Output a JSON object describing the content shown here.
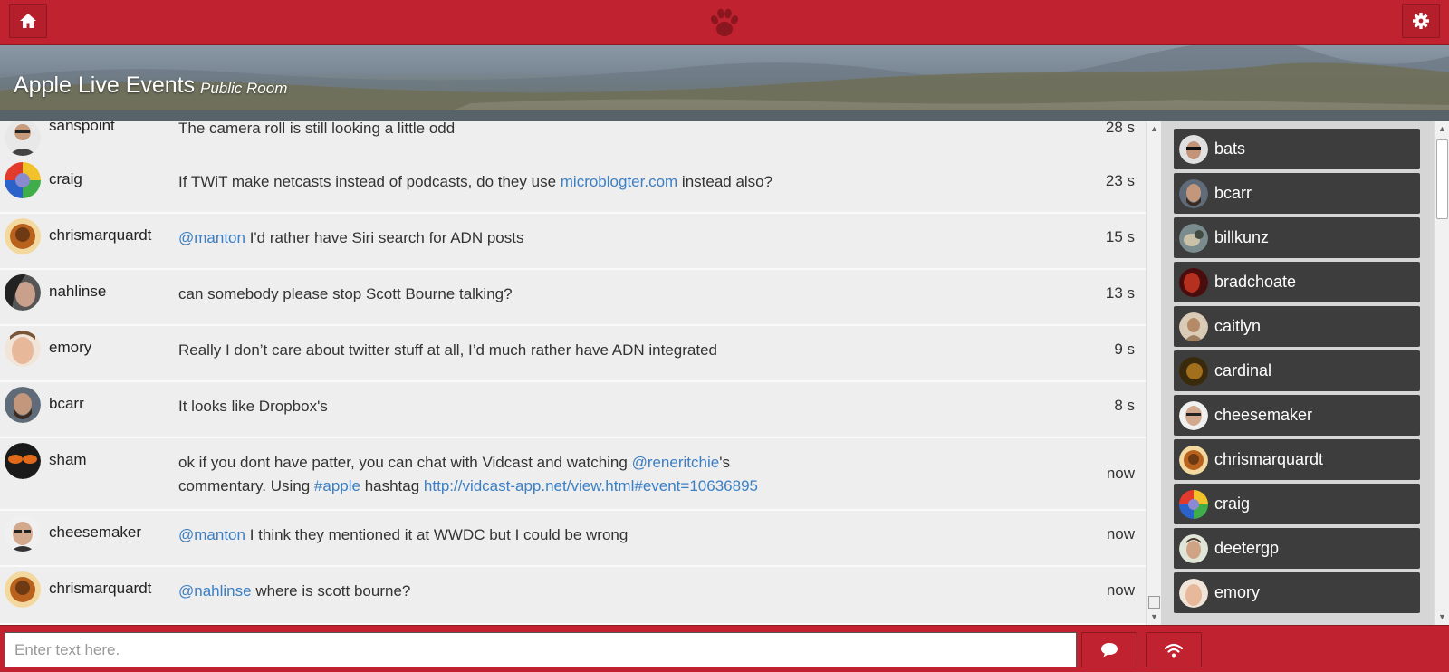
{
  "room": {
    "title": "Apple Live Events",
    "type": "Public Room"
  },
  "input": {
    "placeholder": "Enter text here."
  },
  "colors": {
    "accent": "#c0222f",
    "link": "#3b7fc4",
    "user_chip": "#3d3d3d"
  },
  "icons": {
    "home": "home-icon",
    "settings": "gear-icon",
    "logo": "paw-icon",
    "send": "chat-bubble-icon",
    "stream": "wifi-icon"
  },
  "messages": [
    {
      "user": "sanspoint",
      "time": "28 s",
      "parts": [
        {
          "t": "The camera roll is still looking a little odd"
        }
      ]
    },
    {
      "user": "craig",
      "time": "23 s",
      "parts": [
        {
          "t": "If TWiT make netcasts instead of podcasts, do they use "
        },
        {
          "t": "microblogter.com",
          "link": true
        },
        {
          "t": " instead also?"
        }
      ]
    },
    {
      "user": "chrismarquardt",
      "time": "15 s",
      "parts": [
        {
          "t": "@manton",
          "link": true
        },
        {
          "t": " I'd rather have Siri search for ADN posts"
        }
      ]
    },
    {
      "user": "nahlinse",
      "time": "13 s",
      "parts": [
        {
          "t": "can somebody please stop Scott Bourne talking?"
        }
      ]
    },
    {
      "user": "emory",
      "time": "9 s",
      "parts": [
        {
          "t": "Really I don’t care about twitter stuff at all, I’d much rather have ADN integrated"
        }
      ]
    },
    {
      "user": "bcarr",
      "time": "8 s",
      "parts": [
        {
          "t": "It looks like Dropbox's"
        }
      ]
    },
    {
      "user": "sham",
      "time": "now",
      "parts": [
        {
          "t": "ok if you dont have patter, you can chat with Vidcast and watching "
        },
        {
          "t": "@reneritchie",
          "link": true
        },
        {
          "t": "'s commentary. Using "
        },
        {
          "t": "#apple",
          "link": true
        },
        {
          "t": " hashtag "
        },
        {
          "t": "http://vidcast-app.net/view.html#event=10636895",
          "link": true
        }
      ]
    },
    {
      "user": "cheesemaker",
      "time": "now",
      "parts": [
        {
          "t": "@manton",
          "link": true
        },
        {
          "t": " I think they mentioned it at WWDC but I could be wrong"
        }
      ]
    },
    {
      "user": "chrismarquardt",
      "time": "now",
      "parts": [
        {
          "t": "@nahlinse",
          "link": true
        },
        {
          "t": " where is scott bourne?"
        }
      ]
    }
  ],
  "users": [
    "bats",
    "bcarr",
    "billkunz",
    "bradchoate",
    "caitlyn",
    "cardinal",
    "cheesemaker",
    "chrismarquardt",
    "craig",
    "deetergp",
    "emory"
  ]
}
